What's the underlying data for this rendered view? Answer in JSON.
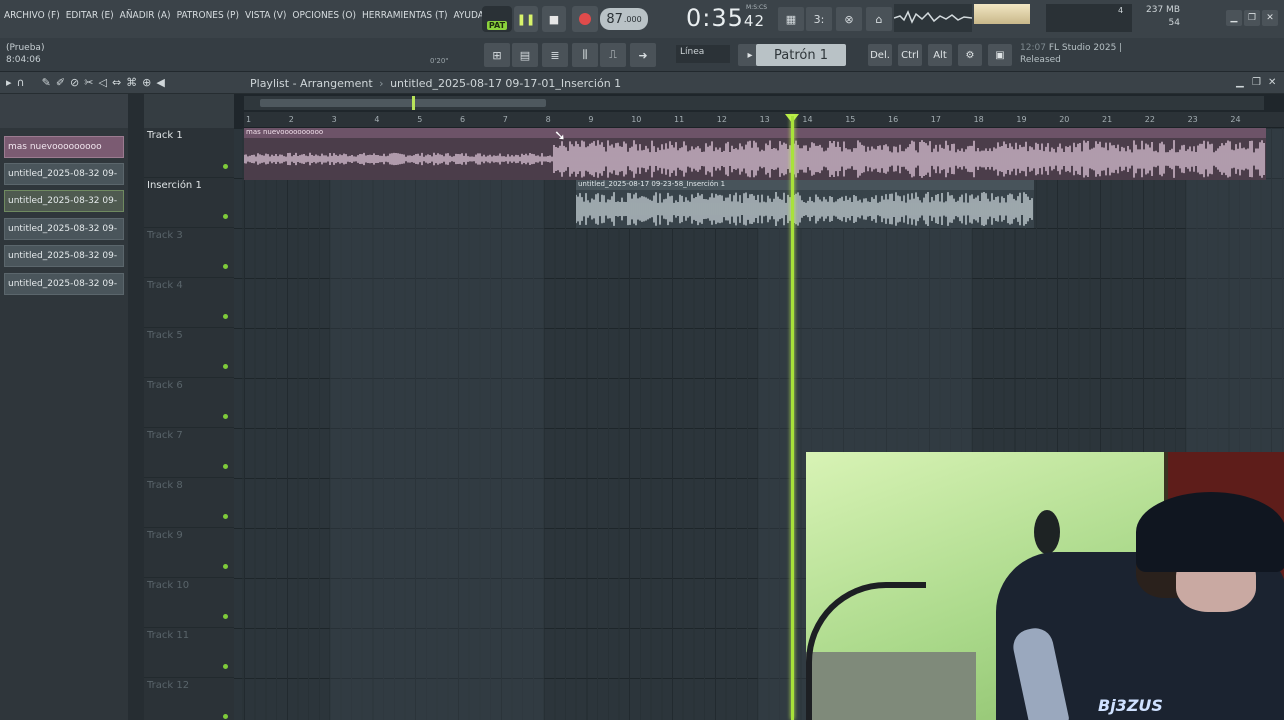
{
  "menu": [
    "ARCHIVO (F)",
    "EDITAR (E)",
    "AÑADIR (A)",
    "PATRONES (P)",
    "VISTA (V)",
    "OPCIONES (O)",
    "HERRAMIENTAS (T)",
    "AYUDA"
  ],
  "transport": {
    "pat_label": "PAT",
    "tempo": "87",
    "tempo_decimal": ".000",
    "time_main": "0:35",
    "time_sub": "42",
    "time_unit": "M:S:CS"
  },
  "system": {
    "cpu_value": "4",
    "memory": "237 MB",
    "memory_sub": "54"
  },
  "hint": {
    "line1": "(Prueba)",
    "line2": "8:04:06",
    "small": "0'20\""
  },
  "toolbar2": {
    "snap": "Línea",
    "pattern": "Patrón 1",
    "btn_del": "Del.",
    "btn_ctrl": "Ctrl",
    "btn_alt": "Alt"
  },
  "news": {
    "line1_time": "12:07",
    "line1_text": "FL Studio 2025 |",
    "line2": "Released"
  },
  "playlist": {
    "title": "Playlist - Arrangement",
    "sep": "›",
    "file": "untitled_2025-08-17 09-17-01_Inserción 1"
  },
  "browser_items": [
    "mas nuevooooooooo",
    "untitled_2025-08-32 09-",
    "untitled_2025-08-32 09-",
    "untitled_2025-08-32 09-",
    "untitled_2025-08-32 09-",
    "untitled_2025-08-32 09-"
  ],
  "tracks": [
    "Track 1",
    "Inserción 1",
    "Track 3",
    "Track 4",
    "Track 5",
    "Track 6",
    "Track 7",
    "Track 8",
    "Track 9",
    "Track 10",
    "Track 11",
    "Track 12"
  ],
  "clips": {
    "clip1_label": "mas nuevoooooooooo",
    "clip1_marker": "4.180",
    "clip2_label": "untitled_2025-08-17 09-23-58_Inserción 1"
  },
  "ruler_labels": [
    "1",
    "2",
    "3",
    "4",
    "5",
    "6",
    "7",
    "8",
    "9",
    "10",
    "11",
    "12",
    "13",
    "14",
    "15",
    "16",
    "17",
    "18",
    "19",
    "20",
    "21",
    "22",
    "23",
    "24"
  ],
  "webcam": {
    "shirt_text": "Bj3ZUS"
  },
  "colors": {
    "accent_green": "#a8e23a",
    "clip_pink": "#6d5368",
    "record": "#e04b4b"
  },
  "icons": [
    "play-icon",
    "stop-icon",
    "record-icon",
    "magnet-icon",
    "pencil-icon",
    "mute-icon",
    "zoom-icon",
    "speaker-icon"
  ]
}
